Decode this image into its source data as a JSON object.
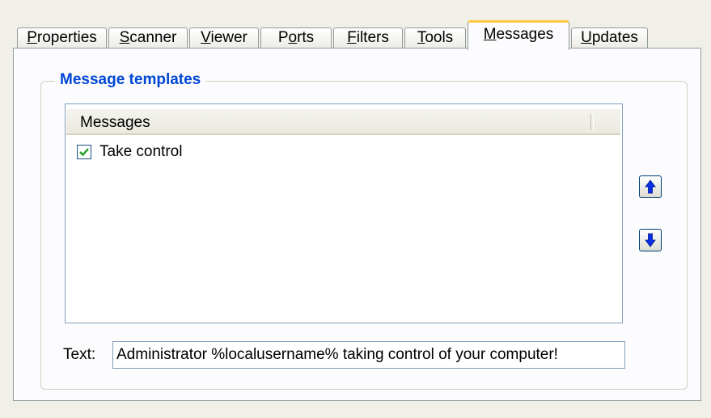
{
  "tabs": [
    {
      "pre": "",
      "key": "P",
      "post": "roperties"
    },
    {
      "pre": "",
      "key": "S",
      "post": "canner"
    },
    {
      "pre": "",
      "key": "V",
      "post": "iewer"
    },
    {
      "pre": "P",
      "key": "o",
      "post": "rts"
    },
    {
      "pre": "",
      "key": "F",
      "post": "ilters"
    },
    {
      "pre": "",
      "key": "T",
      "post": "ools"
    },
    {
      "pre": "",
      "key": "M",
      "post": "essages"
    },
    {
      "pre": "",
      "key": "U",
      "post": "pdates"
    }
  ],
  "active_tab": "Messages",
  "group": {
    "title": "Message templates"
  },
  "list": {
    "header": "Messages",
    "items": [
      {
        "label": "Take control",
        "checked": true
      }
    ]
  },
  "buttons": {
    "move_up_icon": "up-arrow-icon",
    "move_down_icon": "down-arrow-icon"
  },
  "text_field": {
    "label": "Text:",
    "value": "Administrator %localusername% taking control of your computer!"
  },
  "colors": {
    "group_title": "#0046d5",
    "active_tab_accent": "#ffc83c",
    "arrow": "#0a2ee6",
    "check": "#21a121"
  }
}
